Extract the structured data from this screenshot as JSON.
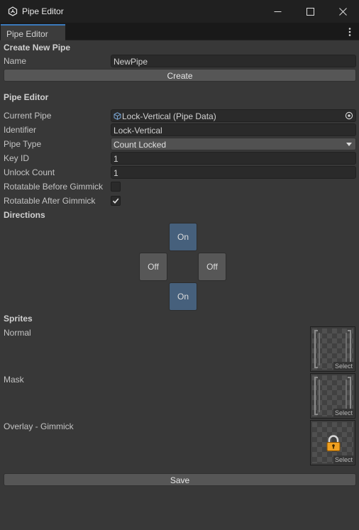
{
  "window": {
    "title": "Pipe Editor"
  },
  "tab": {
    "label": "Pipe Editor"
  },
  "create_section": {
    "header": "Create New Pipe",
    "name_label": "Name",
    "name_value": "NewPipe",
    "create_button": "Create"
  },
  "editor_section": {
    "header": "Pipe Editor",
    "current_pipe_label": "Current Pipe",
    "current_pipe_value": "Lock-Vertical (Pipe Data)",
    "identifier_label": "Identifier",
    "identifier_value": "Lock-Vertical",
    "pipe_type_label": "Pipe Type",
    "pipe_type_value": "Count Locked",
    "key_id_label": "Key ID",
    "key_id_value": "1",
    "unlock_count_label": "Unlock Count",
    "unlock_count_value": "1",
    "rotatable_before_label": "Rotatable Before Gimmick",
    "rotatable_before_checked": false,
    "rotatable_after_label": "Rotatable After Gimmick",
    "rotatable_after_checked": true
  },
  "directions": {
    "header": "Directions",
    "up": "On",
    "left": "Off",
    "right": "Off",
    "down": "On"
  },
  "sprites": {
    "header": "Sprites",
    "normal_label": "Normal",
    "mask_label": "Mask",
    "overlay_label": "Overlay - Gimmick",
    "select_label": "Select"
  },
  "save_button": "Save",
  "colors": {
    "accent": "#3a79bb",
    "direction_on": "#46607c",
    "direction_off": "#575757",
    "background": "#383838"
  },
  "icons": {
    "app": "unity-icon",
    "minimize": "minimize-icon",
    "maximize": "maximize-icon",
    "close": "close-icon",
    "menu": "kebab-menu-icon",
    "object": "scriptable-object-icon",
    "picker": "object-picker-icon",
    "dropdown": "chevron-down-icon",
    "check": "checkmark-icon",
    "lock": "padlock-icon"
  }
}
